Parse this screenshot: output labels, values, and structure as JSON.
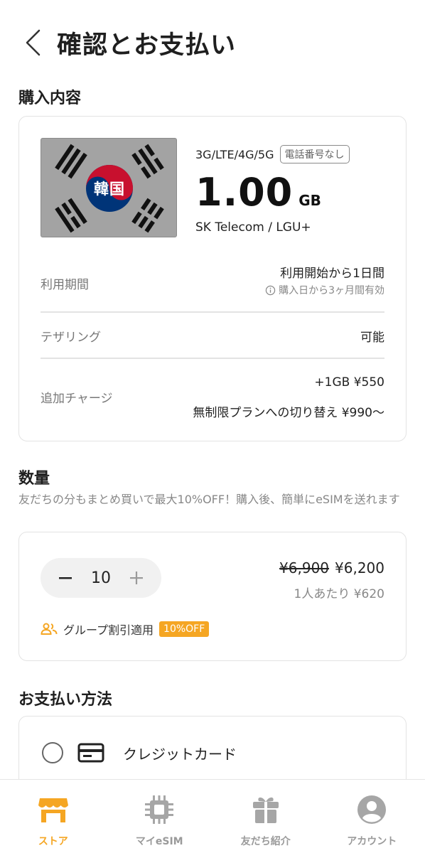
{
  "header": {
    "title": "確認とお支払い"
  },
  "purchase": {
    "section_title": "購入内容",
    "flag_label": "韓国",
    "network": "3G/LTE/4G/5G",
    "no_phone_badge": "電話番号なし",
    "data_value": "1.00",
    "data_unit": "GB",
    "carrier": "SK Telecom / LGU+",
    "period_label": "利用期間",
    "period_value": "利用開始から1日間",
    "period_note": "購入日から3ヶ月間有効",
    "tethering_label": "テザリング",
    "tethering_value": "可能",
    "topup_label": "追加チャージ",
    "topup_line1": "+1GB ¥550",
    "topup_line2": "無制限プランへの切り替え ¥990〜"
  },
  "quantity": {
    "section_title": "数量",
    "subtitle": "友だちの分もまとめ買いで最大10%OFF！購入後、簡単にeSIMを送れます",
    "count": "10",
    "price_original": "¥6,900",
    "price_discounted": "¥6,200",
    "per_person": "1人あたり ¥620",
    "group_label": "グループ割引適用",
    "discount_badge": "10%OFF"
  },
  "payment": {
    "section_title": "お支払い方法",
    "option_label": "クレジットカード"
  },
  "nav": {
    "items": [
      {
        "label": "ストア",
        "icon": "store-icon",
        "active": true
      },
      {
        "label": "マイeSIM",
        "icon": "chip-icon",
        "active": false
      },
      {
        "label": "友だち紹介",
        "icon": "gift-icon",
        "active": false
      },
      {
        "label": "アカウント",
        "icon": "account-icon",
        "active": false
      }
    ]
  },
  "colors": {
    "accent": "#f5a623",
    "flag_red": "#c8102e",
    "flag_blue": "#003478"
  }
}
